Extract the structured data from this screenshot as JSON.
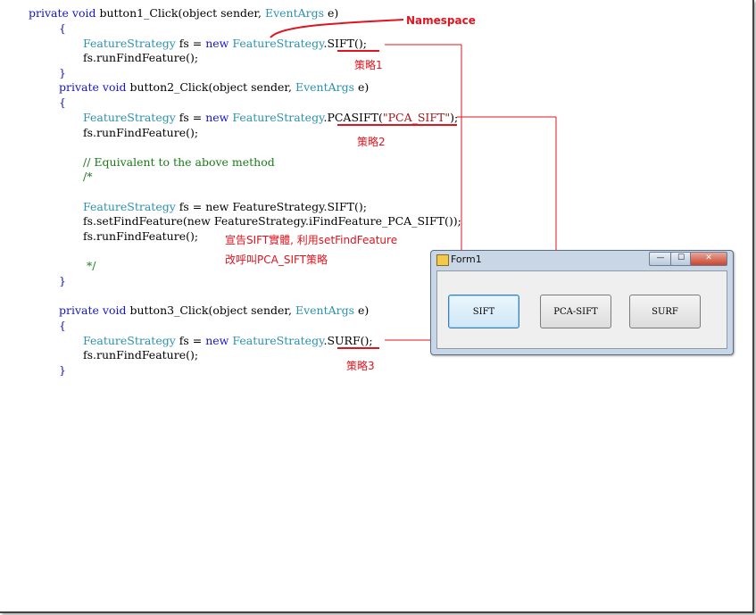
{
  "code_lines": [
    {
      "indent": 0,
      "segments": [
        {
          "c": "kw",
          "t": "private void "
        },
        {
          "c": "pl",
          "t": "button1_Click(object sender, "
        },
        {
          "c": "ty",
          "t": "EventArgs"
        },
        {
          "c": "pl",
          "t": " e)"
        }
      ]
    },
    {
      "indent": 1,
      "segments": [
        {
          "c": "br",
          "t": "{"
        }
      ]
    },
    {
      "indent": 2,
      "segments": [
        {
          "c": "ty",
          "t": "FeatureStrategy"
        },
        {
          "c": "pl",
          "t": " fs = "
        },
        {
          "c": "kw",
          "t": "new "
        },
        {
          "c": "ty",
          "t": "FeatureStrategy"
        },
        {
          "c": "pl",
          "t": ".SIFT();"
        }
      ]
    },
    {
      "indent": 2,
      "segments": [
        {
          "c": "pl",
          "t": "fs.runFindFeature();"
        }
      ]
    },
    {
      "indent": 1,
      "segments": [
        {
          "c": "br",
          "t": "}"
        }
      ]
    },
    {
      "indent": 1,
      "segments": [
        {
          "c": "kw",
          "t": "private void "
        },
        {
          "c": "pl",
          "t": "button2_Click(object sender, "
        },
        {
          "c": "ty",
          "t": "EventArgs"
        },
        {
          "c": "pl",
          "t": " e)"
        }
      ]
    },
    {
      "indent": 1,
      "segments": [
        {
          "c": "br",
          "t": "{"
        }
      ]
    },
    {
      "indent": 2,
      "segments": [
        {
          "c": "ty",
          "t": "FeatureStrategy"
        },
        {
          "c": "pl",
          "t": " fs = "
        },
        {
          "c": "kw",
          "t": "new "
        },
        {
          "c": "ty",
          "t": "FeatureStrategy"
        },
        {
          "c": "pl",
          "t": ".PCASIFT("
        },
        {
          "c": "st",
          "t": "\"PCA_SIFT\""
        },
        {
          "c": "pl",
          "t": ");"
        }
      ]
    },
    {
      "indent": 2,
      "segments": [
        {
          "c": "pl",
          "t": "fs.runFindFeature();"
        }
      ]
    },
    {
      "indent": 2,
      "segments": []
    },
    {
      "indent": 2,
      "segments": [
        {
          "c": "cm",
          "t": "// Equivalent to the above method"
        }
      ]
    },
    {
      "indent": 2,
      "segments": [
        {
          "c": "cm",
          "t": "/*"
        }
      ]
    },
    {
      "indent": 2,
      "segments": []
    },
    {
      "indent": 2,
      "segments": [
        {
          "c": "ty",
          "t": "FeatureStrategy"
        },
        {
          "c": "pl",
          "t": " fs = new FeatureStrategy.SIFT();"
        }
      ]
    },
    {
      "indent": 2,
      "segments": [
        {
          "c": "pl",
          "t": "fs.setFindFeature(new FeatureStrategy.iFindFeature_PCA_SIFT());"
        }
      ]
    },
    {
      "indent": 2,
      "segments": [
        {
          "c": "pl",
          "t": "fs.runFindFeature();"
        }
      ]
    },
    {
      "indent": 2,
      "segments": []
    },
    {
      "indent": 2,
      "segments": [
        {
          "c": "cm",
          "t": " */"
        }
      ]
    },
    {
      "indent": 1,
      "segments": [
        {
          "c": "br",
          "t": "}"
        }
      ]
    },
    {
      "indent": 1,
      "segments": []
    },
    {
      "indent": 1,
      "segments": [
        {
          "c": "kw",
          "t": "private void "
        },
        {
          "c": "pl",
          "t": "button3_Click(object sender, "
        },
        {
          "c": "ty",
          "t": "EventArgs"
        },
        {
          "c": "pl",
          "t": " e)"
        }
      ]
    },
    {
      "indent": 1,
      "segments": [
        {
          "c": "br",
          "t": "{"
        }
      ]
    },
    {
      "indent": 2,
      "segments": [
        {
          "c": "ty",
          "t": "FeatureStrategy"
        },
        {
          "c": "pl",
          "t": " fs = "
        },
        {
          "c": "kw",
          "t": "new "
        },
        {
          "c": "ty",
          "t": "FeatureStrategy"
        },
        {
          "c": "pl",
          "t": ".SURF();"
        }
      ]
    },
    {
      "indent": 2,
      "segments": [
        {
          "c": "pl",
          "t": "fs.runFindFeature();"
        }
      ]
    },
    {
      "indent": 1,
      "segments": [
        {
          "c": "br",
          "t": "}"
        }
      ]
    }
  ],
  "annotations": {
    "namespace": "Namespace",
    "strategy1": "策略1",
    "strategy2": "策略2",
    "strategy3": "策略3",
    "note_line1": "宣告SIFT實體, 利用setFindFeature",
    "note_line2": "改呼叫PCA_SIFT策略"
  },
  "form": {
    "title": "Form1",
    "buttons": [
      "SIFT",
      "PCA-SIFT",
      "SURF"
    ],
    "controls": {
      "minimize": "—",
      "maximize": "☐",
      "close": "✕"
    }
  },
  "colors": {
    "keyword": "#1515c8",
    "type": "#2b91af",
    "comment": "#1a7a1a",
    "string": "#a31515",
    "annotation": "#e0141e"
  }
}
